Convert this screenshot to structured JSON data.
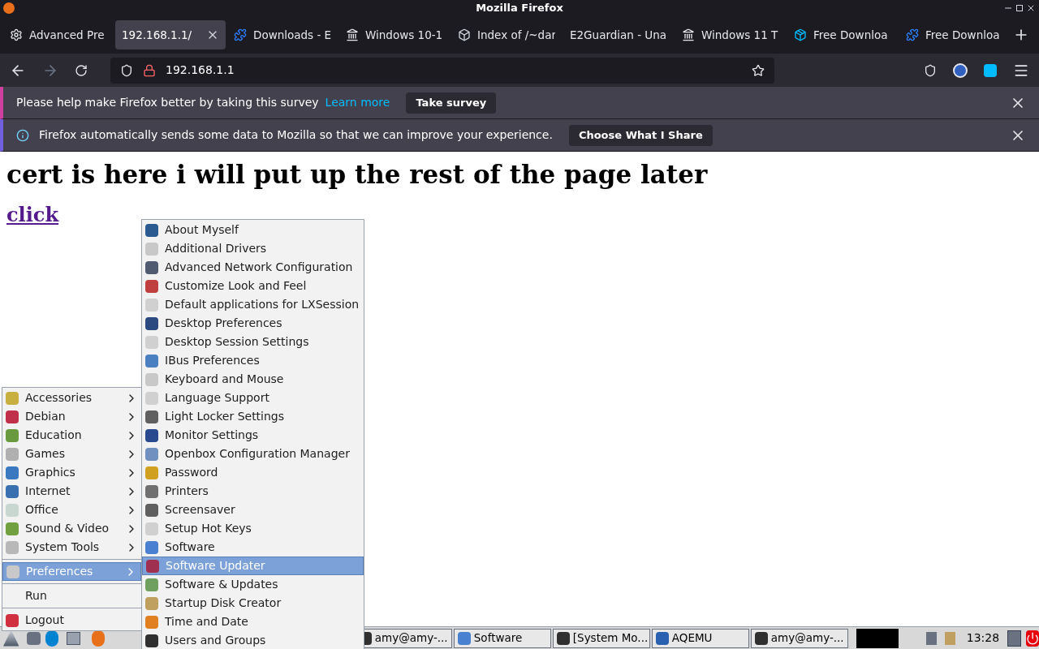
{
  "window": {
    "title": "Mozilla Firefox"
  },
  "tabs": [
    {
      "label": "Advanced Pre",
      "selected": false,
      "kind": "gear"
    },
    {
      "label": "192.168.1.1/",
      "selected": true,
      "kind": "none"
    },
    {
      "label": "Downloads - E",
      "selected": false,
      "kind": "puzzle"
    },
    {
      "label": "Windows 10-1",
      "selected": false,
      "kind": "building"
    },
    {
      "label": "Index of /~dar",
      "selected": false,
      "kind": "cube"
    },
    {
      "label": "E2Guardian - Una",
      "selected": false,
      "kind": "none"
    },
    {
      "label": "Windows 11 T",
      "selected": false,
      "kind": "building"
    },
    {
      "label": "Free Downloa",
      "selected": false,
      "kind": "box"
    },
    {
      "label": "Free Downloa",
      "selected": false,
      "kind": "puzzle"
    }
  ],
  "address": {
    "value": "192.168.1.1"
  },
  "notifications": [
    {
      "kind": "survey",
      "text": "Please help make Firefox better by taking this survey",
      "link": "Learn more",
      "button": "Take survey"
    },
    {
      "kind": "info",
      "text": "Firefox automatically sends some data to Mozilla so that we can improve your experience.",
      "button": "Choose What I Share"
    }
  ],
  "page": {
    "heading": "cert is here i will put up the rest of the page later",
    "link": "click"
  },
  "main_menu": [
    {
      "label": "Accessories",
      "kind": "sub",
      "selected": false,
      "color": "#c8b040"
    },
    {
      "label": "Debian",
      "kind": "sub",
      "selected": false,
      "color": "#c0304a"
    },
    {
      "label": "Education",
      "kind": "sub",
      "selected": false,
      "color": "#6a9a40"
    },
    {
      "label": "Games",
      "kind": "sub",
      "selected": false,
      "color": "#b0b0b0"
    },
    {
      "label": "Graphics",
      "kind": "sub",
      "selected": false,
      "color": "#3a78c0"
    },
    {
      "label": "Internet",
      "kind": "sub",
      "selected": false,
      "color": "#3a70b0"
    },
    {
      "label": "Office",
      "kind": "sub",
      "selected": false,
      "color": "#c8d8d0"
    },
    {
      "label": "Sound & Video",
      "kind": "sub",
      "selected": false,
      "color": "#70a040"
    },
    {
      "label": "System Tools",
      "kind": "sub",
      "selected": false,
      "color": "#b8b8b8"
    },
    {
      "label": "Preferences",
      "kind": "sub",
      "selected": true,
      "color": "#c8c8c8"
    },
    {
      "label": "Run",
      "kind": "plain",
      "selected": false
    },
    {
      "label": "Logout",
      "kind": "plain",
      "selected": false,
      "color": "#d03040"
    }
  ],
  "submenu": [
    {
      "label": "About Myself",
      "selected": false,
      "color": "#2a5a90"
    },
    {
      "label": "Additional Drivers",
      "selected": false,
      "color": "#c8c8c8"
    },
    {
      "label": "Advanced Network Configuration",
      "selected": false,
      "color": "#505a70"
    },
    {
      "label": "Customize Look and Feel",
      "selected": false,
      "color": "#c04040"
    },
    {
      "label": "Default applications for LXSession",
      "selected": false,
      "color": "#d0d0d0"
    },
    {
      "label": "Desktop Preferences",
      "selected": false,
      "color": "#2a4a80"
    },
    {
      "label": "Desktop Session Settings",
      "selected": false,
      "color": "#d0d0d0"
    },
    {
      "label": "IBus Preferences",
      "selected": false,
      "color": "#4a80c0"
    },
    {
      "label": "Keyboard and Mouse",
      "selected": false,
      "color": "#c8c8c8"
    },
    {
      "label": "Language Support",
      "selected": false,
      "color": "#d0d0d0"
    },
    {
      "label": "Light Locker Settings",
      "selected": false,
      "color": "#606060"
    },
    {
      "label": "Monitor Settings",
      "selected": false,
      "color": "#2a4a90"
    },
    {
      "label": "Openbox Configuration Manager",
      "selected": false,
      "color": "#7090c0"
    },
    {
      "label": "Password",
      "selected": false,
      "color": "#d0a020"
    },
    {
      "label": "Printers",
      "selected": false,
      "color": "#707070"
    },
    {
      "label": "Screensaver",
      "selected": false,
      "color": "#606060"
    },
    {
      "label": "Setup Hot Keys",
      "selected": false,
      "color": "#d0d0d0"
    },
    {
      "label": "Software",
      "selected": false,
      "color": "#4a80d0"
    },
    {
      "label": "Software Updater",
      "selected": true,
      "color": "#a03050"
    },
    {
      "label": "Software & Updates",
      "selected": false,
      "color": "#70a060"
    },
    {
      "label": "Startup Disk Creator",
      "selected": false,
      "color": "#c0a060"
    },
    {
      "label": "Time and Date",
      "selected": false,
      "color": "#e08020"
    },
    {
      "label": "Users and Groups",
      "selected": false,
      "color": "#303030"
    }
  ],
  "taskbar": {
    "tasks": [
      {
        "label": "amy@amy-...",
        "color": "#303030"
      },
      {
        "label": "Software",
        "color": "#4a80d0"
      },
      {
        "label": "[System Mo...",
        "color": "#303030"
      },
      {
        "label": "AQEMU",
        "color": "#2a60b0"
      },
      {
        "label": "amy@amy-...",
        "color": "#303030"
      }
    ],
    "clock": "13:28"
  }
}
